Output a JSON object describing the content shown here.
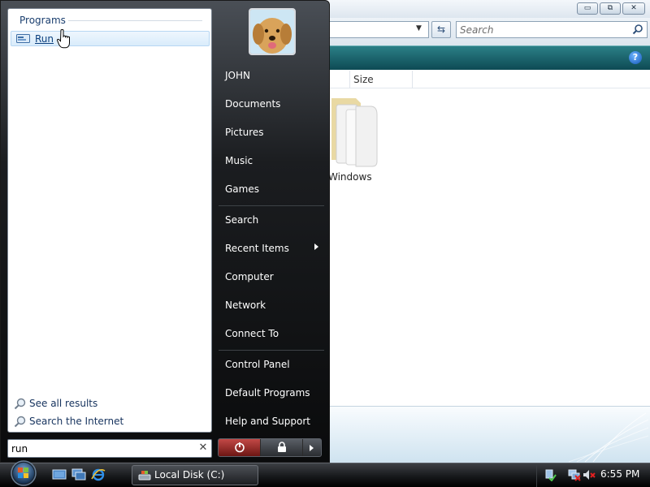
{
  "explorer": {
    "search_placeholder": "Search",
    "column_size": "Size",
    "folder_label": "Windows",
    "window_buttons": {
      "minimize": "▭",
      "maximize": "⧉",
      "close": "✕"
    },
    "help_label": "?"
  },
  "start_menu": {
    "programs_header": "Programs",
    "run_label": "Run",
    "see_all_results": "See all results",
    "search_internet": "Search the Internet",
    "search_value": "run",
    "search_clear": "✕",
    "right_items": {
      "user": "JOHN",
      "documents": "Documents",
      "pictures": "Pictures",
      "music": "Music",
      "games": "Games",
      "search": "Search",
      "recent_items": "Recent Items",
      "computer": "Computer",
      "network": "Network",
      "connect_to": "Connect To",
      "control_panel": "Control Panel",
      "default_programs": "Default Programs",
      "help_support": "Help and Support"
    }
  },
  "taskbar": {
    "task_label": "Local Disk (C:)",
    "clock": "6:55 PM"
  },
  "colors": {
    "accent": "#1a3e6e",
    "toolbar_teal": "#1a6670",
    "menu_dark": "#0a0b0c",
    "power_red": "#b83a38"
  },
  "icons": [
    "run-icon",
    "hand-cursor-icon",
    "magnifier-icon",
    "power-icon",
    "lock-icon",
    "folder-icon",
    "windows-orb-icon",
    "show-desktop-icon",
    "switch-windows-icon",
    "internet-explorer-icon",
    "drive-icon",
    "network-icon",
    "volume-muted-icon",
    "help-icon",
    "refresh-icon"
  ]
}
